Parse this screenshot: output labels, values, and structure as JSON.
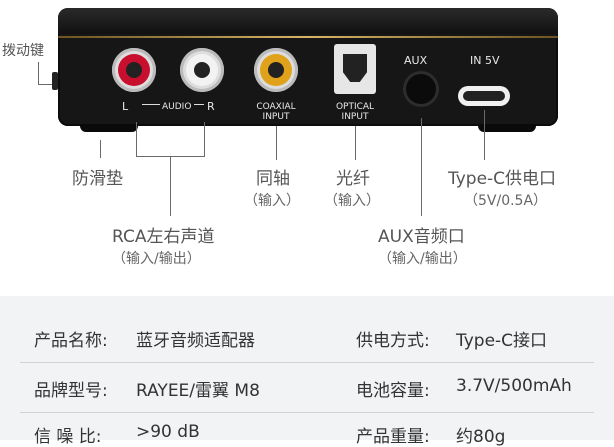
{
  "device": {
    "ports": {
      "audio_left": "L",
      "audio_mid": "AUDIO",
      "audio_right": "R",
      "coaxial_line1": "COAXIAL",
      "coaxial_line2": "INPUT",
      "optical_line1": "OPTICAL",
      "optical_line2": "INPUT",
      "aux": "AUX",
      "in5v": "IN 5V"
    }
  },
  "annotations": {
    "switch_key": "拨动键",
    "anti_slip": "防滑垫",
    "coaxial": "同轴",
    "coaxial_sub": "（输入）",
    "optical": "光纤",
    "optical_sub": "（输入）",
    "typec": "Type-C供电口",
    "typec_sub": "（5V/0.5A）",
    "rca": "RCA左右声道",
    "rca_sub": "（输入/输出）",
    "aux": "AUX音频口",
    "aux_sub": "（输入/输出）"
  },
  "specs": {
    "rows": [
      {
        "label1": "产品名称:",
        "value1": "蓝牙音频适配器",
        "label2": "供电方式:",
        "value2": "Type-C接口"
      },
      {
        "label1": "品牌型号:",
        "value1": "RAYEE/雷翼 M8",
        "label2": "电池容量:",
        "value2": "3.7V/500mAh"
      },
      {
        "label1": "信 噪 比:",
        "value1": ">90 dB",
        "label2": "产品重量:",
        "value2": "约80g"
      }
    ]
  }
}
